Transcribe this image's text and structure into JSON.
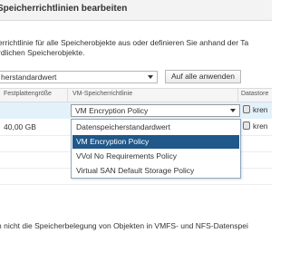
{
  "dialog": {
    "title": "Speicherrichtlinien bearbeiten"
  },
  "description": [
    "errichtlinie für alle Speicherobjekte aus oder definieren Sie anhand der Ta",
    "rdlichen Speicherobjekte."
  ],
  "policy_select": {
    "value": "herstandardwert"
  },
  "apply_all_button": {
    "label": "Auf alle anwenden"
  },
  "table": {
    "columns": [
      "Festplattengröße",
      "VM-Speicherrichtlinie",
      "Datastore"
    ],
    "rows": [
      {
        "size": "",
        "policy": "VM Encryption Policy",
        "datastore": "kren",
        "selected": true
      },
      {
        "size": "40,00 GB",
        "policy": "",
        "datastore": "kren",
        "selected": false
      }
    ]
  },
  "dropdown": {
    "options": [
      "Datenspeicherstandardwert",
      "VM Encryption Policy",
      "VVol No Requirements Policy",
      "Virtual SAN Default Storage Policy"
    ],
    "highlighted_index": 1,
    "highlight_color": "#1f5889"
  },
  "footer_note": "n nicht die Speicherbelegung von Objekten in VMFS- und NFS-Datenspei",
  "colors": {
    "selected_row": "#e3f1fb",
    "header_bg": "#f5f5f5"
  },
  "icons": {
    "datastore": "datastore-icon",
    "caret": "chevron-down-icon"
  }
}
